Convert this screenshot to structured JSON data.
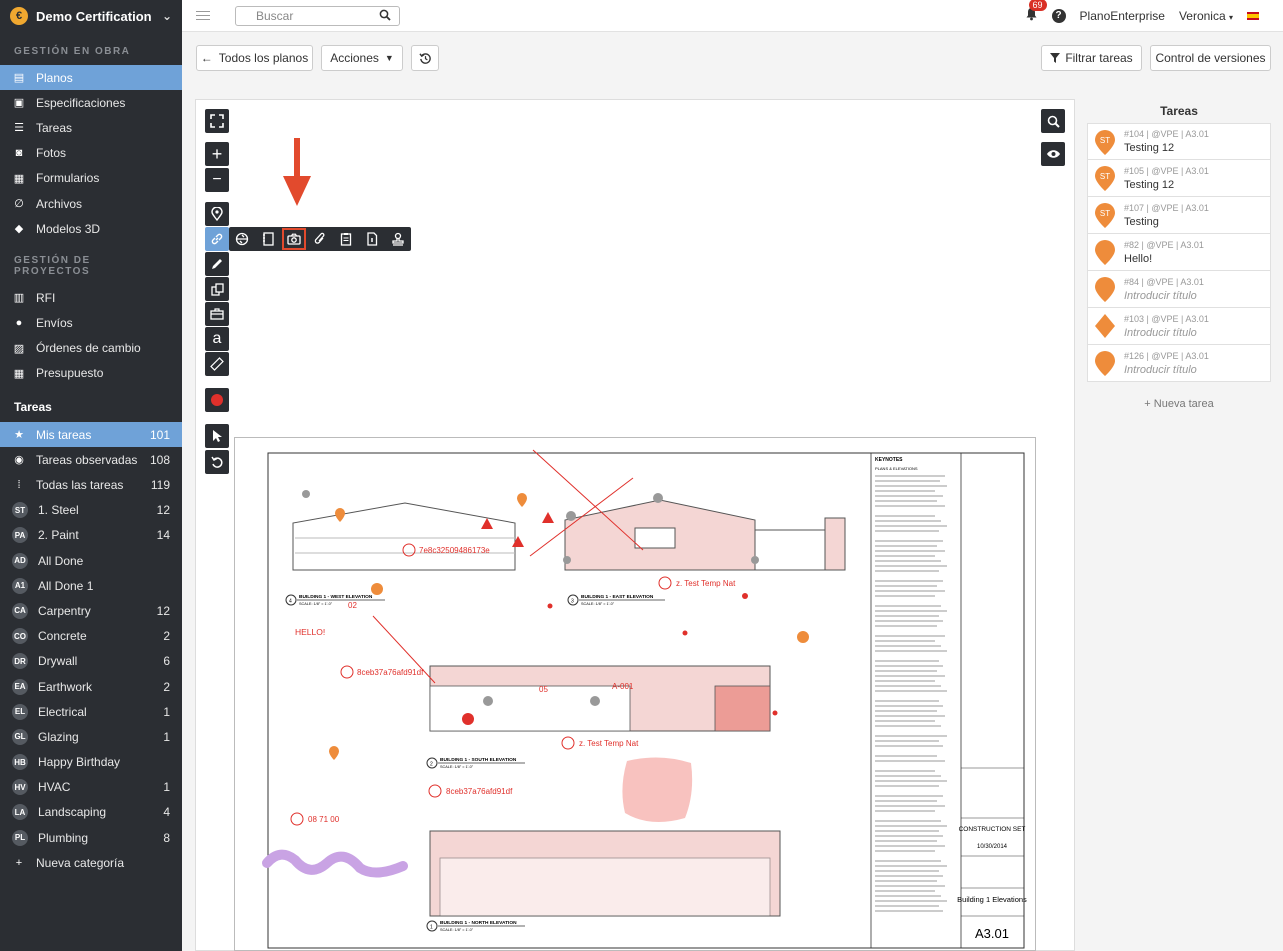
{
  "sidebar": {
    "company": "Demo Certification",
    "sections": {
      "obra": "GESTIÓN EN OBRA",
      "proyectos": "GESTIÓN DE PROYECTOS",
      "tareas": "Tareas"
    },
    "obra_items": [
      {
        "label": "Planos",
        "icon": "plans-icon"
      },
      {
        "label": "Especificaciones",
        "icon": "specs-icon"
      },
      {
        "label": "Tareas",
        "icon": "list-icon"
      },
      {
        "label": "Fotos",
        "icon": "camera-icon"
      },
      {
        "label": "Formularios",
        "icon": "clipboard-icon"
      },
      {
        "label": "Archivos",
        "icon": "paperclip-icon"
      },
      {
        "label": "Modelos 3D",
        "icon": "cube-icon"
      }
    ],
    "proyectos_items": [
      {
        "label": "RFI",
        "icon": "rfi-icon"
      },
      {
        "label": "Envíos",
        "icon": "user-icon"
      },
      {
        "label": "Órdenes de cambio",
        "icon": "change-order-icon"
      },
      {
        "label": "Presupuesto",
        "icon": "calculator-icon"
      }
    ],
    "task_filters": [
      {
        "label": "Mis tareas",
        "count": "101",
        "icon": "star-icon"
      },
      {
        "label": "Tareas observadas",
        "count": "108",
        "icon": "eye-icon"
      },
      {
        "label": "Todas las tareas",
        "count": "119",
        "icon": "grid-icon"
      }
    ],
    "categories": [
      {
        "code": "ST",
        "label": "1. Steel",
        "count": "12"
      },
      {
        "code": "PA",
        "label": "2. Paint",
        "count": "14"
      },
      {
        "code": "AD",
        "label": "All Done",
        "count": ""
      },
      {
        "code": "A1",
        "label": "All Done 1",
        "count": ""
      },
      {
        "code": "CA",
        "label": "Carpentry",
        "count": "12"
      },
      {
        "code": "CO",
        "label": "Concrete",
        "count": "2"
      },
      {
        "code": "DR",
        "label": "Drywall",
        "count": "6"
      },
      {
        "code": "EA",
        "label": "Earthwork",
        "count": "2"
      },
      {
        "code": "EL",
        "label": "Electrical",
        "count": "1"
      },
      {
        "code": "GL",
        "label": "Glazing",
        "count": "1"
      },
      {
        "code": "HB",
        "label": "Happy Birthday",
        "count": ""
      },
      {
        "code": "HV",
        "label": "HVAC",
        "count": "1"
      },
      {
        "code": "LA",
        "label": "Landscaping",
        "count": "4"
      },
      {
        "code": "PL",
        "label": "Plumbing",
        "count": "8"
      }
    ],
    "new_category": "Nueva categoría"
  },
  "topbar": {
    "search_placeholder": "Buscar",
    "notifications": "69",
    "plan": "PlanoEnterprise",
    "user": "Veronica"
  },
  "actions": {
    "all_plans": "Todos los planos",
    "actions": "Acciones",
    "filter": "Filtrar tareas",
    "versions": "Control de versiones"
  },
  "tasks": {
    "title": "Tareas",
    "items": [
      {
        "meta": "#104 | @VPE | A3.01",
        "title": "Testing 12",
        "badge": "ST",
        "shape": "pin",
        "placeholder": false
      },
      {
        "meta": "#105 | @VPE | A3.01",
        "title": "Testing 12",
        "badge": "ST",
        "shape": "pin",
        "placeholder": false
      },
      {
        "meta": "#107 | @VPE | A3.01",
        "title": "Testing",
        "badge": "ST",
        "shape": "pin",
        "placeholder": false
      },
      {
        "meta": "#82 | @VPE | A3.01",
        "title": "Hello!",
        "badge": "",
        "shape": "pin",
        "placeholder": false
      },
      {
        "meta": "#84 | @VPE | A3.01",
        "title": "Introducir título",
        "badge": "",
        "shape": "pin",
        "placeholder": true
      },
      {
        "meta": "#103 | @VPE | A3.01",
        "title": "Introducir título",
        "badge": "",
        "shape": "diamond",
        "placeholder": true
      },
      {
        "meta": "#126 | @VPE | A3.01",
        "title": "Introducir título",
        "badge": "",
        "shape": "pin",
        "placeholder": true
      }
    ],
    "new_task": "+ Nueva tarea"
  },
  "drawing": {
    "keynotes_title": "KEYNOTES",
    "plans_elevations": "PLANS & ELEVATIONS",
    "views": [
      {
        "num": "4",
        "label": "BUILDING 1 - WEST ELEVATION",
        "scale": "SCALE: 1/8\" = 1'-0\""
      },
      {
        "num": "3",
        "label": "BUILDING 1 - EAST ELEVATION",
        "scale": "SCALE: 1/8\" = 1'-0\""
      },
      {
        "num": "2",
        "label": "BUILDING 1 - SOUTH ELEVATION",
        "scale": "SCALE: 1/8\" = 1'-0\""
      },
      {
        "num": "1",
        "label": "BUILDING 1 - NORTH ELEVATION",
        "scale": "SCALE: 1/8\" = 1'-0\""
      }
    ],
    "annotations": {
      "a1": "7e8c32509486173e",
      "a2": "z. Test Temp Nat",
      "a3": "8ceb37a76afd91df",
      "a4": "z. Test Temp Nat",
      "a5": "8ceb37a76afd91df",
      "a6": "08 71 00",
      "hello": "HELLO!",
      "n02": "02",
      "n05": "05",
      "a001": "A-001"
    },
    "title_block": {
      "set": "CONSTRUCTION SET",
      "date": "10/30/2014",
      "sheet_title": "Building 1 Elevations",
      "sheet_no": "A3.01"
    }
  },
  "colors": {
    "sidebar_bg": "#2b2e33",
    "accent": "#6fa2d8",
    "markup_red": "#e0302b",
    "pin_orange": "#ee8c3b",
    "highlight_pink": "#f7b7b4",
    "stroke_purple": "#c9a3e4"
  }
}
